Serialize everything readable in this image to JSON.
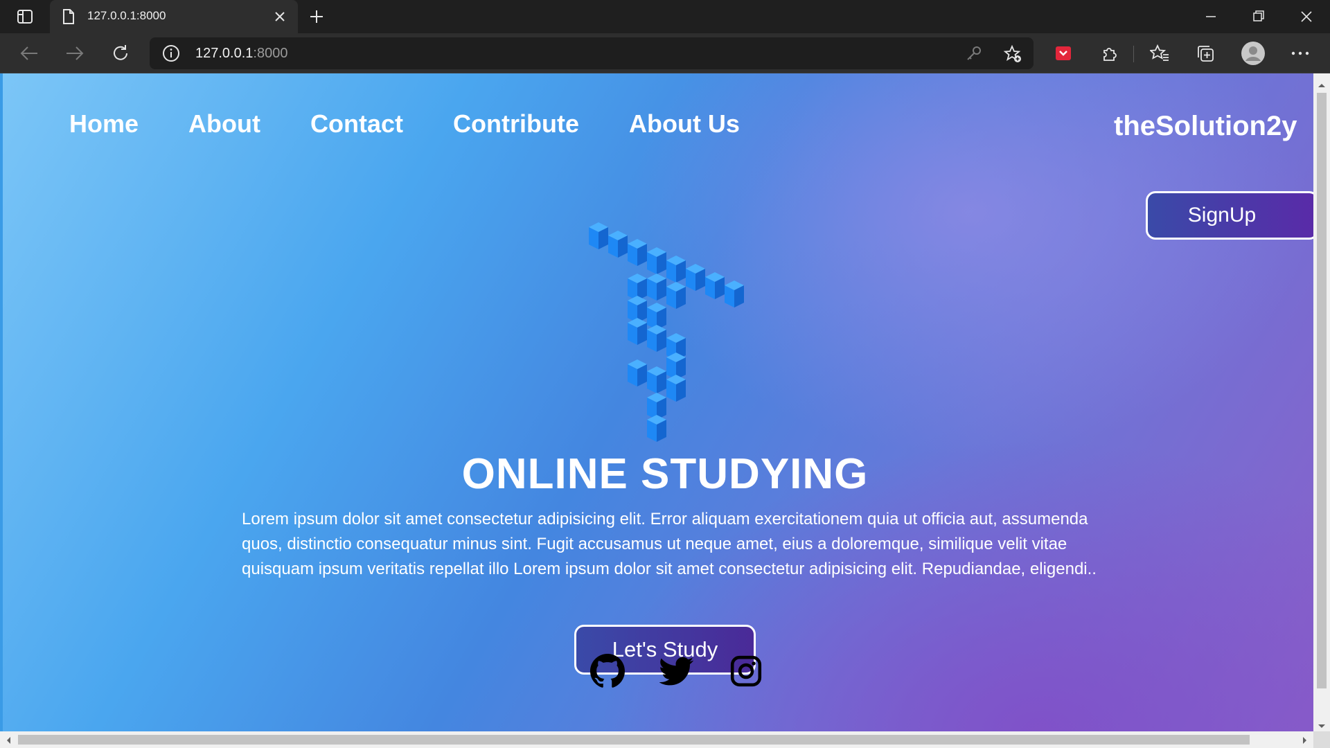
{
  "browser": {
    "tab_title": "127.0.0.1:8000",
    "url_host": "127.0.0.1",
    "url_port": ":8000"
  },
  "nav": {
    "links": [
      "Home",
      "About",
      "Contact",
      "Contribute",
      "About Us"
    ],
    "brand": "theSolution2y"
  },
  "signup_label": "SignUp",
  "hero": {
    "title": "ONLINE STUDYING",
    "text": "Lorem ipsum dolor sit amet consectetur adipisicing elit. Error aliquam exercitationem quia ut officia aut, assumenda quos, distinctio consequatur minus sint. Fugit accusamus ut neque amet, eius a doloremque, similique velit vitae quisquam ipsum veritatis repellat illo Lorem ipsum dolor sit amet consectetur adipisicing elit. Repudiandae, eligendi..",
    "cta_label": "Let's Study"
  },
  "social_icons": [
    "github-icon",
    "twitter-icon",
    "instagram-icon"
  ],
  "colors": {
    "accent": "#1e88f5",
    "button_start": "#3a4aa8",
    "button_end": "#5a2aa8"
  }
}
